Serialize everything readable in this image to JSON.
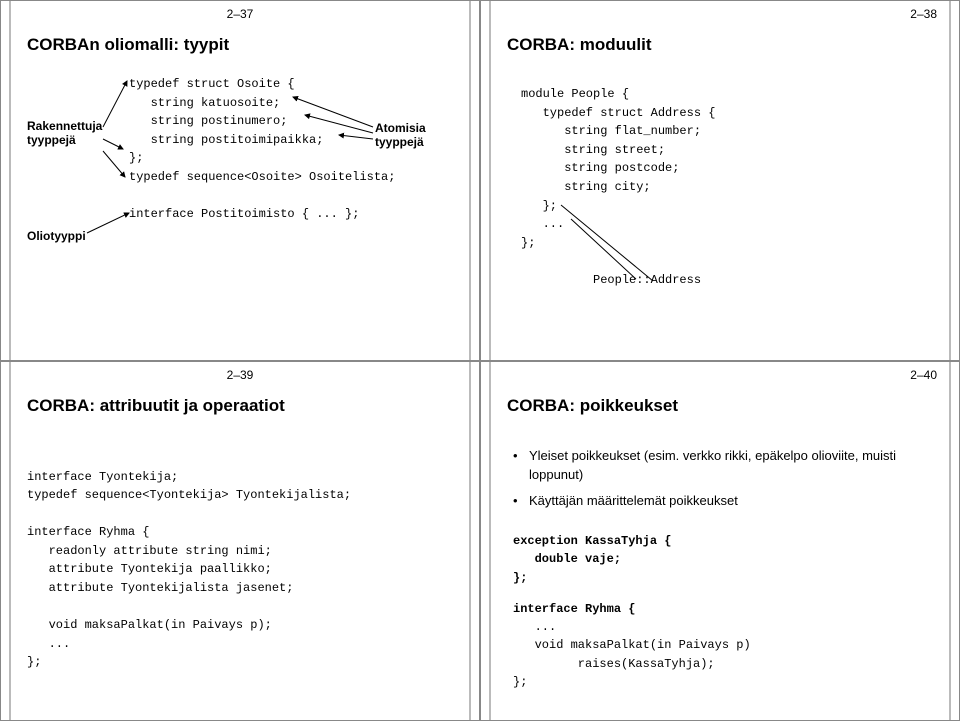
{
  "slides": {
    "s37": {
      "pageNum": "2–37",
      "title": "CORBAn oliomalli: tyypit",
      "labels": {
        "rakennettuja1": "Rakennettuja",
        "rakennettuja2": "tyyppejä",
        "atomisia1": "Atomisia",
        "atomisia2": "tyyppejä",
        "oliotyyppi": "Oliotyyppi"
      },
      "code": "typedef struct Osoite {\n   string katuosoite;\n   string postinumero;\n   string postitoimipaikka;\n};\ntypedef sequence<Osoite> Osoitelista;\n\ninterface Postitoimisto { ... };"
    },
    "s38": {
      "pageNum": "2–38",
      "title": "CORBA: moduulit",
      "code": "module People {\n   typedef struct Address {\n      string flat_number;\n      string street;\n      string postcode;\n      string city;\n   };\n   ...\n};\n\n          People::Address"
    },
    "s39": {
      "pageNum": "2–39",
      "title": "CORBA: attribuutit ja operaatiot",
      "code": "interface Tyontekija;\ntypedef sequence<Tyontekija> Tyontekijalista;\n\ninterface Ryhma {\n   readonly attribute string nimi;\n   attribute Tyontekija paallikko;\n   attribute Tyontekijalista jasenet;\n\n   void maksaPalkat(in Paivays p);\n   ...\n};"
    },
    "s40": {
      "pageNum": "2–40",
      "title": "CORBA: poikkeukset",
      "bullets": [
        "Yleiset poikkeukset (esim. verkko rikki, epäkelpo olioviite, muisti loppunut)",
        "Käyttäjän määrittelemät poikkeukset"
      ],
      "code1": "exception KassaTyhja {\n   double vaje;\n};",
      "code2": "interface Ryhma {",
      "code3": "   ...\n   void maksaPalkat(in Paivays p)\n         raises(KassaTyhja);\n};"
    }
  }
}
